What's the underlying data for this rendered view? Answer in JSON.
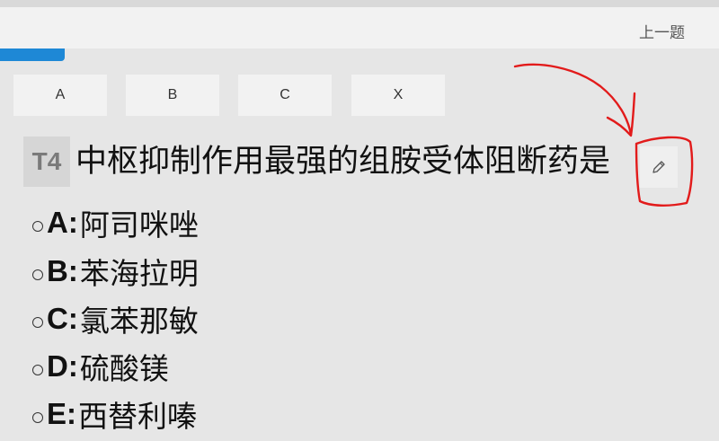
{
  "header": {
    "prev_label": "上一题"
  },
  "option_tabs": [
    "A",
    "B",
    "C",
    "X"
  ],
  "question": {
    "number": "T4",
    "text": "中枢抑制作用最强的组胺受体阻断药是"
  },
  "choices": [
    {
      "letter": "A:",
      "text": "阿司咪唑"
    },
    {
      "letter": "B:",
      "text": "苯海拉明"
    },
    {
      "letter": "C:",
      "text": "氯苯那敏"
    },
    {
      "letter": "D:",
      "text": "硫酸镁"
    },
    {
      "letter": "E:",
      "text": "西替利嗪"
    }
  ],
  "icons": {
    "edit": "pencil-icon",
    "radio": "radio-circle-icon"
  },
  "colors": {
    "progress": "#1e88d6",
    "annotation": "#e21b1b"
  }
}
